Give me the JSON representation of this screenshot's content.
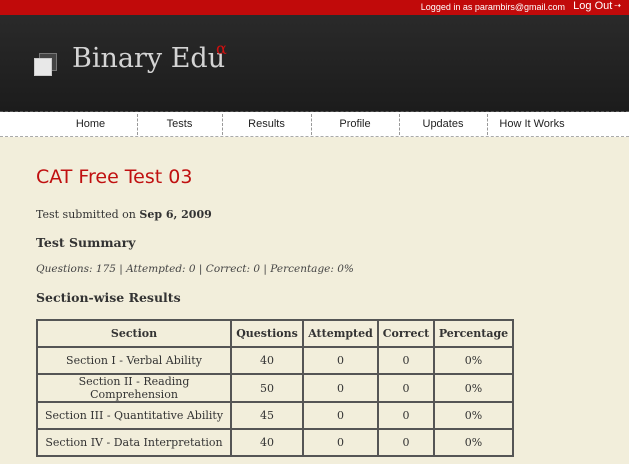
{
  "topbar": {
    "logged_in_text": "Logged in as parambirs@gmail.com",
    "logout_label": "Log Out",
    "logout_arrow": "⇢"
  },
  "header": {
    "brand": "Binary Edu",
    "brand_superscript": "α"
  },
  "nav": {
    "items": [
      "Home",
      "Tests",
      "Results",
      "Profile",
      "Updates",
      "How It Works"
    ]
  },
  "main": {
    "title": "CAT Free Test 03",
    "submitted_prefix": "Test submitted on ",
    "submitted_date": "Sep 6, 2009",
    "summary_heading": "Test Summary",
    "summary_line": "Questions: 175 | Attempted: 0 | Correct: 0 | Percentage: 0%",
    "section_heading": "Section-wise Results",
    "table": {
      "headers": [
        "Section",
        "Questions",
        "Attempted",
        "Correct",
        "Percentage"
      ],
      "rows": [
        [
          "Section I - Verbal Ability",
          "40",
          "0",
          "0",
          "0%"
        ],
        [
          "Section II - Reading Comprehension",
          "50",
          "0",
          "0",
          "0%"
        ],
        [
          "Section III - Quantitative Ability",
          "45",
          "0",
          "0",
          "0%"
        ],
        [
          "Section IV - Data Interpretation",
          "40",
          "0",
          "0",
          "0%"
        ]
      ]
    }
  },
  "colors": {
    "topbar": "#c10a0a",
    "header_bg": "#1c1c1c",
    "page_bg": "#f2eedb",
    "title": "#c01010"
  }
}
